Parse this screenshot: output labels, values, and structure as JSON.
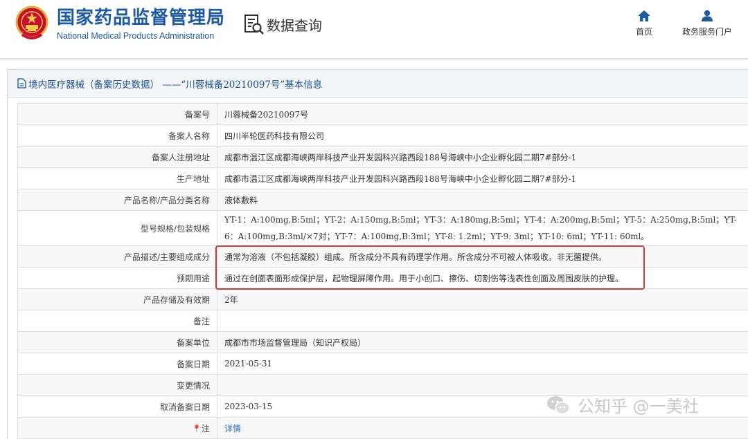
{
  "header": {
    "brand_cn": "国家药品监督管理局",
    "brand_en": "National Medical Products Administration",
    "query_label": "数据查询",
    "nav": [
      {
        "label": "首页",
        "icon": "home-icon"
      },
      {
        "label": "政务服务门户",
        "icon": "user-icon"
      }
    ]
  },
  "panel": {
    "title": "境内医疗器械（备案历史数据） ——“川蓉械备20210097号”基本信息"
  },
  "rows": [
    {
      "label": "备案号",
      "value": "川蓉械备20210097号"
    },
    {
      "label": "备案人名称",
      "value": "四川半轮医药科技有限公司"
    },
    {
      "label": "备案人注册地址",
      "value": "成都市温江区成都海峡两岸科技产业开发园科兴路西段188号海峡中小企业孵化园二期7#部分-1"
    },
    {
      "label": "生产地址",
      "value": "成都市温江区成都海峡两岸科技产业开发园科兴路西段188号海峡中小企业孵化园二期7#部分-1"
    },
    {
      "label": "产品名称/产品分类名称",
      "value": "液体敷料"
    },
    {
      "label": "型号规格/包装规格",
      "value": "YT-1：A:100mg,B:5ml；YT-2：A:150mg,B:5ml；YT-3：A:180mg,B:5ml；YT-4：A:200mg,B:5ml；YT-5：A:250mg,B:5ml；YT-6：A:100mg,B:3ml/×7对；YT-7：A:100mg,B:3ml；YT-8: 1.2ml；YT-9: 3ml；YT-10: 6ml；YT-11: 60ml。"
    },
    {
      "label": "产品描述/主要组成成分",
      "value": "通常为溶液（不包括凝胶）组成。所含成分不具有药理学作用。所含成分不可被人体吸收。非无菌提供。"
    },
    {
      "label": "预期用途",
      "value": "通过在创面表面形成保护层，起物理屏障作用。用于小创口、擦伤、切割伤等浅表性创面及周围皮肤的护理。"
    },
    {
      "label": "产品存储及有效期",
      "value": "2年"
    },
    {
      "label": "备注",
      "value": ""
    },
    {
      "label": "备案单位",
      "value": "成都市市场监督管理局（知识产权局）"
    },
    {
      "label": "备案日期",
      "value": "2021-05-31"
    },
    {
      "label": "变更情况",
      "value": ""
    },
    {
      "label": "取消备案日期",
      "value": "2023-03-15"
    },
    {
      "label": "注",
      "value": "详情"
    }
  ],
  "watermark": {
    "text": "公知乎 @一美社"
  },
  "colors": {
    "brand_blue": "#1c5aa6",
    "highlight_red": "#d33a2f",
    "link_blue": "#2a6bb8"
  }
}
